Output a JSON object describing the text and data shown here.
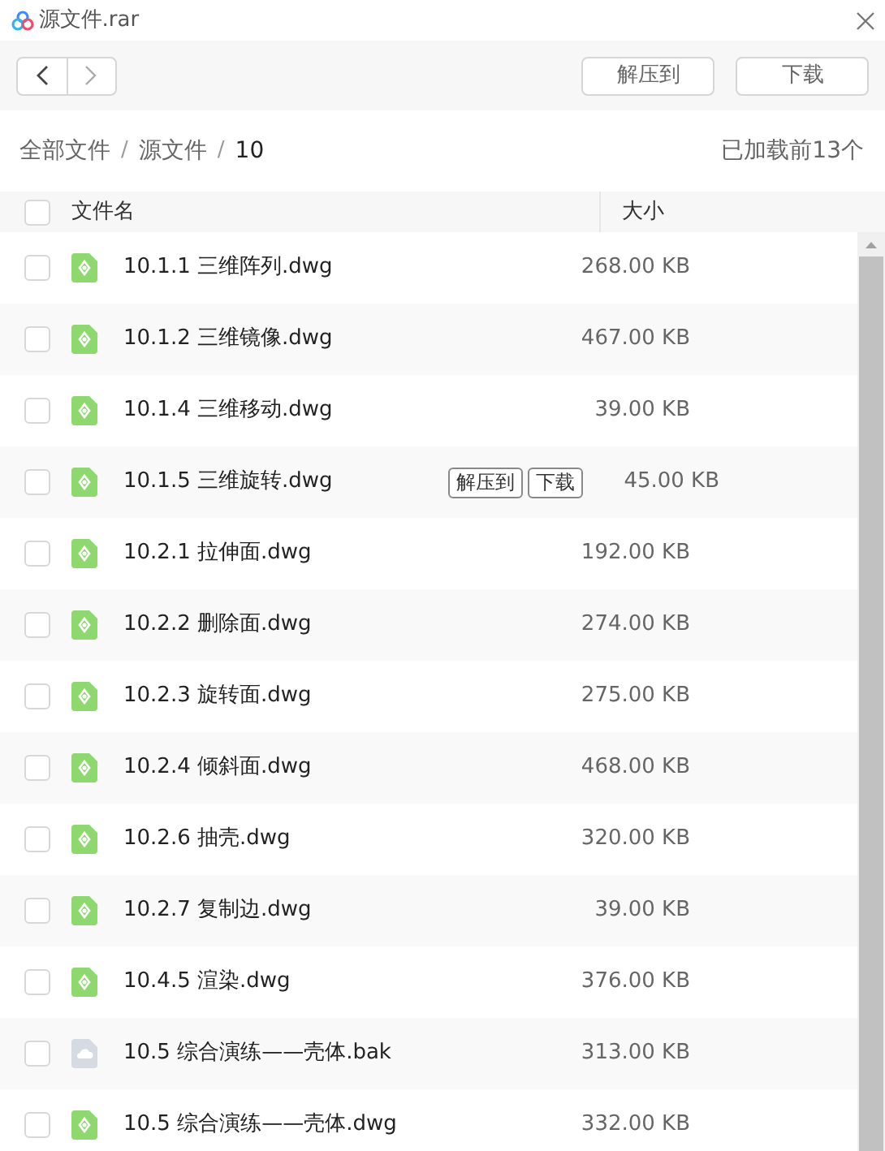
{
  "window": {
    "title": "源文件.rar"
  },
  "toolbar": {
    "buttons": [
      "解压到",
      "下载"
    ]
  },
  "breadcrumb": {
    "items": [
      "全部文件",
      "源文件",
      "10"
    ],
    "separators": [
      "/",
      "/"
    ]
  },
  "loaded_count": "已加载前13个",
  "table": {
    "columns": [
      "文件名",
      "大小"
    ],
    "all_checked": false,
    "rows": [
      {
        "kind": "dwg",
        "name": "10.1.1 三维阵列.dwg",
        "size": "268.00 KB",
        "checked": false
      },
      {
        "kind": "dwg",
        "name": "10.1.2 三维镜像.dwg",
        "size": "467.00 KB",
        "checked": false
      },
      {
        "kind": "dwg",
        "name": "10.1.4 三维移动.dwg",
        "size": "39.00 KB",
        "checked": false
      },
      {
        "kind": "dwg",
        "name": "10.1.5 三维旋转.dwg",
        "size": "45.00 KB",
        "checked": false,
        "actions": [
          "解压到",
          "下载"
        ]
      },
      {
        "kind": "dwg",
        "name": "10.2.1 拉伸面.dwg",
        "size": "192.00 KB",
        "checked": false
      },
      {
        "kind": "dwg",
        "name": "10.2.2 删除面.dwg",
        "size": "274.00 KB",
        "checked": false
      },
      {
        "kind": "dwg",
        "name": "10.2.3 旋转面.dwg",
        "size": "275.00 KB",
        "checked": false
      },
      {
        "kind": "dwg",
        "name": "10.2.4 倾斜面.dwg",
        "size": "468.00 KB",
        "checked": false
      },
      {
        "kind": "dwg",
        "name": "10.2.6 抽壳.dwg",
        "size": "320.00 KB",
        "checked": false
      },
      {
        "kind": "dwg",
        "name": "10.2.7 复制边.dwg",
        "size": "39.00 KB",
        "checked": false
      },
      {
        "kind": "dwg",
        "name": "10.4.5 渲染.dwg",
        "size": "376.00 KB",
        "checked": false
      },
      {
        "kind": "bak",
        "name": "10.5 综合演练——壳体.bak",
        "size": "313.00 KB",
        "checked": false
      },
      {
        "kind": "dwg",
        "name": "10.5 综合演练——壳体.dwg",
        "size": "332.00 KB",
        "checked": false
      }
    ]
  }
}
